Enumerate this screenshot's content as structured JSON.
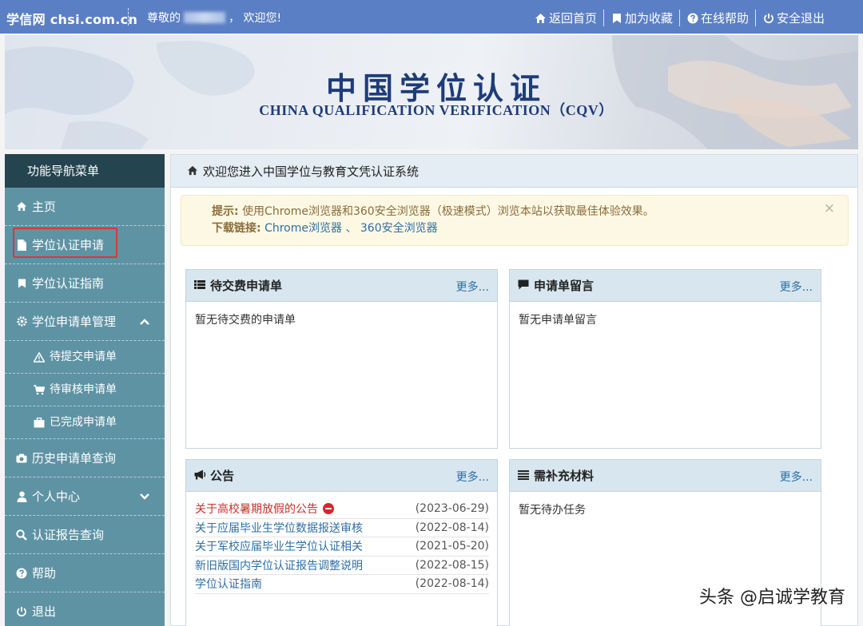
{
  "topbar": {
    "brand": "学信网 chsi.com.cn",
    "greet_prefix": "尊敬的",
    "greet_suffix": "，  欢迎您!",
    "links": [
      "返回首页",
      "加为收藏",
      "在线帮助",
      "安全退出"
    ]
  },
  "banner": {
    "title_cn": "中国学位认证",
    "title_en": "CHINA QUALIFICATION VERIFICATION（CQV）"
  },
  "sidebar": {
    "header": "功能导航菜单",
    "items": [
      {
        "label": "主页",
        "icon": "home-icon"
      },
      {
        "label": "学位认证申请",
        "icon": "file-icon"
      },
      {
        "label": "学位认证指南",
        "icon": "bookmark-icon"
      },
      {
        "label": "学位申请单管理",
        "icon": "gear-icon"
      },
      {
        "label": "待提交申请单",
        "icon": "warning-icon"
      },
      {
        "label": "待审核申请单",
        "icon": "cart-icon"
      },
      {
        "label": "已完成申请单",
        "icon": "briefcase-icon"
      },
      {
        "label": "历史申请单查询",
        "icon": "camera-icon"
      },
      {
        "label": "个人中心",
        "icon": "user-icon"
      },
      {
        "label": "认证报告查询",
        "icon": "search-icon"
      },
      {
        "label": "帮助",
        "icon": "question-icon"
      },
      {
        "label": "退出",
        "icon": "power-icon"
      }
    ]
  },
  "main": {
    "title": "欢迎您进入中国学位与教育文凭认证系统",
    "alert": {
      "tip_label": "提示:",
      "tip_text": "使用Chrome浏览器和360安全浏览器（极速模式）浏览本站以获取最佳体验效果。",
      "download_label": "下载链接:",
      "link1": "Chrome浏览器",
      "sep": "、",
      "link2": "360安全浏览器",
      "close": "×"
    },
    "more": "更多...",
    "boxes": {
      "pending_pay": {
        "title": "待交费申请单",
        "empty": "暂无待交费的申请单"
      },
      "messages": {
        "title": "申请单留言",
        "empty": "暂无申请单留言"
      },
      "notice": {
        "title": "公告",
        "rows": [
          {
            "text": "关于高校暑期放假的公告",
            "date": "(2023-06-29)"
          },
          {
            "text": "关于应届毕业生学位数据报送审核",
            "date": "(2022-08-14)"
          },
          {
            "text": "关于军校应届毕业生学位认证相关",
            "date": "(2021-05-20)"
          },
          {
            "text": "新旧版国内学位认证报告调整说明",
            "date": "(2022-08-15)"
          },
          {
            "text": "学位认证指南",
            "date": "(2022-08-14)"
          }
        ]
      },
      "materials": {
        "title": "需补充材料",
        "empty": "暂无待办任务"
      }
    }
  },
  "watermark": "头条 @启诚学教育"
}
